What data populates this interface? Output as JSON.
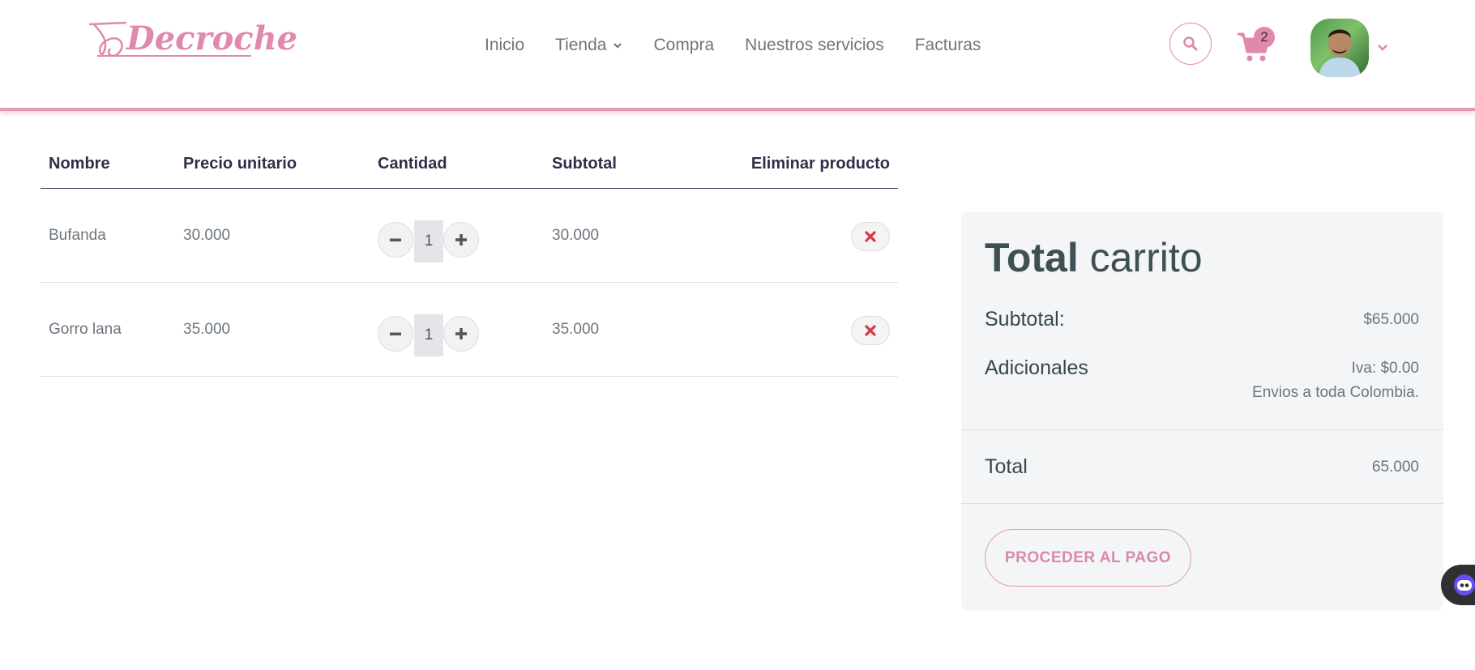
{
  "header": {
    "logo_text": "Decroche",
    "nav": [
      {
        "label": "Inicio"
      },
      {
        "label": "Tienda"
      },
      {
        "label": "Compra"
      },
      {
        "label": "Nuestros servicios"
      },
      {
        "label": "Facturas"
      }
    ],
    "cart_count": "2",
    "icons": {
      "search": "search-icon",
      "cart": "cart-icon",
      "avatar_dropdown": "chevron-down-icon"
    }
  },
  "cart_table": {
    "headers": {
      "name": "Nombre",
      "unit_price": "Precio unitario",
      "quantity": "Cantidad",
      "subtotal": "Subtotal",
      "remove": "Eliminar producto"
    },
    "rows": [
      {
        "name": "Bufanda",
        "unit_price": "30.000",
        "quantity": "1",
        "subtotal": "30.000"
      },
      {
        "name": "Gorro lana",
        "unit_price": "35.000",
        "quantity": "1",
        "subtotal": "35.000"
      }
    ]
  },
  "totals": {
    "title_bold": "Total",
    "title_rest": " carrito",
    "subtotal_label": "Subtotal:",
    "subtotal_value": "$65.000",
    "additional_label": "Adicionales",
    "iva": "Iva: $0.00",
    "shipping": "Envios a toda Colombia.",
    "total_label": "Total",
    "total_value": "65.000",
    "pay_button": "PROCEDER AL PAGO"
  },
  "colors": {
    "accent": "#e088ad",
    "heading": "#2e2f48",
    "text": "#6c757d",
    "danger": "#dc3545",
    "card_bg": "#f3f5f7"
  }
}
